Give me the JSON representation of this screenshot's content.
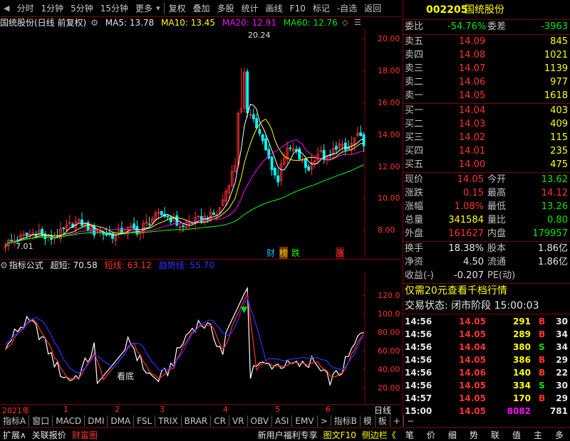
{
  "toolbar": {
    "items": [
      "分时",
      "1分钟",
      "5分钟",
      "15分钟",
      "更多",
      "复权",
      "叠加",
      "多股",
      "统计",
      "画线",
      "F10",
      "标记",
      "-自选",
      "返回"
    ]
  },
  "main_chart": {
    "title": "国统股份(日线 前复权)",
    "ma5": "MA5: 13.78",
    "ma10": "MA10: 13.45",
    "ma20": "MA20: 12.91",
    "ma60": "MA60: 12.76",
    "high_label": "20.24",
    "low_label": "7.01",
    "y_ticks": [
      "20.00",
      "18.00",
      "16.00",
      "14.00",
      "12.00",
      "10.00",
      "8.00"
    ],
    "markers": [
      "财",
      "榜",
      "跌",
      "涨"
    ],
    "colors": {
      "ma5": "#ffffff",
      "ma10": "#ffff00",
      "ma20": "#ff00ff",
      "ma60": "#00ff00",
      "up": "#ff3232",
      "down": "#00ffff"
    }
  },
  "sub_chart": {
    "name": "指标公式",
    "super": "超短: 70.58",
    "short": "短线: 63.12",
    "trend": "趋势线: 55.70",
    "annotation": "看底",
    "y_ticks": [
      "120.0",
      "100.0",
      "80.00",
      "60.00",
      "40.00",
      "20.00"
    ]
  },
  "axis": {
    "year": "2021年",
    "months": [
      "1",
      "2",
      "3",
      "4",
      "5",
      "6"
    ],
    "right_label": "日线"
  },
  "tabs": [
    "指标A",
    "窗口",
    "MACD",
    "DMI",
    "DMA",
    "FSL",
    "TRIX",
    "BRAR",
    "CR",
    "VR",
    "OBV",
    "ASI",
    "EMV"
  ],
  "tabs_right": [
    "指标B",
    "模",
    "板"
  ],
  "status": {
    "left": [
      "扩展∧",
      "关联报价",
      "财富圈"
    ],
    "right": [
      "新用户福利专享",
      "图文F10",
      "侧边栏《"
    ],
    "buttons": [
      "笔",
      "价",
      "细",
      "势",
      "联",
      "值",
      "主",
      "多"
    ]
  },
  "quote": {
    "code": "002205",
    "name": "国统股份",
    "weibi_label": "委比",
    "weibi": "-54.76%",
    "weicha_label": "委差",
    "weicha": "-3963",
    "asks": [
      {
        "label": "卖五",
        "price": "14.09",
        "vol": "845"
      },
      {
        "label": "卖四",
        "price": "14.08",
        "vol": "1021"
      },
      {
        "label": "卖三",
        "price": "14.07",
        "vol": "1139"
      },
      {
        "label": "卖二",
        "price": "14.06",
        "vol": "977"
      },
      {
        "label": "卖一",
        "price": "14.05",
        "vol": "1618"
      }
    ],
    "bids": [
      {
        "label": "买一",
        "price": "14.04",
        "vol": "403"
      },
      {
        "label": "买二",
        "price": "14.03",
        "vol": "409"
      },
      {
        "label": "买三",
        "price": "14.02",
        "vol": "115"
      },
      {
        "label": "买四",
        "price": "14.01",
        "vol": "235"
      },
      {
        "label": "买五",
        "price": "14.00",
        "vol": "475"
      }
    ],
    "stats": [
      {
        "l1": "现价",
        "v1": "14.05",
        "c1": "red",
        "l2": "今开",
        "v2": "13.62",
        "c2": "grn"
      },
      {
        "l1": "涨跌",
        "v1": "0.15",
        "c1": "red",
        "l2": "最高",
        "v2": "14.12",
        "c2": "red"
      },
      {
        "l1": "涨幅",
        "v1": "1.08%",
        "c1": "red",
        "l2": "最低",
        "v2": "13.26",
        "c2": "grn"
      },
      {
        "l1": "总量",
        "v1": "341584",
        "c1": "yel",
        "l2": "量比",
        "v2": "0.80",
        "c2": "grn"
      },
      {
        "l1": "外盘",
        "v1": "161627",
        "c1": "red",
        "l2": "内盘",
        "v2": "179957",
        "c2": "grn"
      }
    ],
    "stats2": [
      {
        "l1": "换手",
        "v1": "18.38%",
        "l2": "股本",
        "v2": "1.86亿"
      },
      {
        "l1": "净资",
        "v1": "4.50",
        "l2": "流通",
        "v2": "1.86亿"
      },
      {
        "l1": "收益(-)",
        "v1": "-0.207",
        "l2": "PE(动)",
        "v2": ""
      }
    ],
    "promo": "仅需20元查看千档行情",
    "trade_status": "交易状态: 闭市阶段 15:00:03",
    "ticks": [
      {
        "t": "14:56",
        "p": "14.05",
        "v": "291",
        "d": "B",
        "n": "30"
      },
      {
        "t": "14:56",
        "p": "14.05",
        "v": "289",
        "d": "B",
        "n": "34"
      },
      {
        "t": "14:56",
        "p": "14.04",
        "v": "380",
        "d": "S",
        "n": "34"
      },
      {
        "t": "14:56",
        "p": "14.05",
        "v": "386",
        "d": "B",
        "n": "29"
      },
      {
        "t": "14:56",
        "p": "14.06",
        "v": "140",
        "d": "B",
        "n": "22"
      },
      {
        "t": "14:56",
        "p": "14.05",
        "v": "334",
        "d": "S",
        "n": "30"
      },
      {
        "t": "14:57",
        "p": "14.05",
        "v": "170",
        "d": "B",
        "n": "29"
      },
      {
        "t": "15:00",
        "p": "14.05",
        "v": "8082",
        "d": "",
        "n": "781"
      }
    ]
  }
}
